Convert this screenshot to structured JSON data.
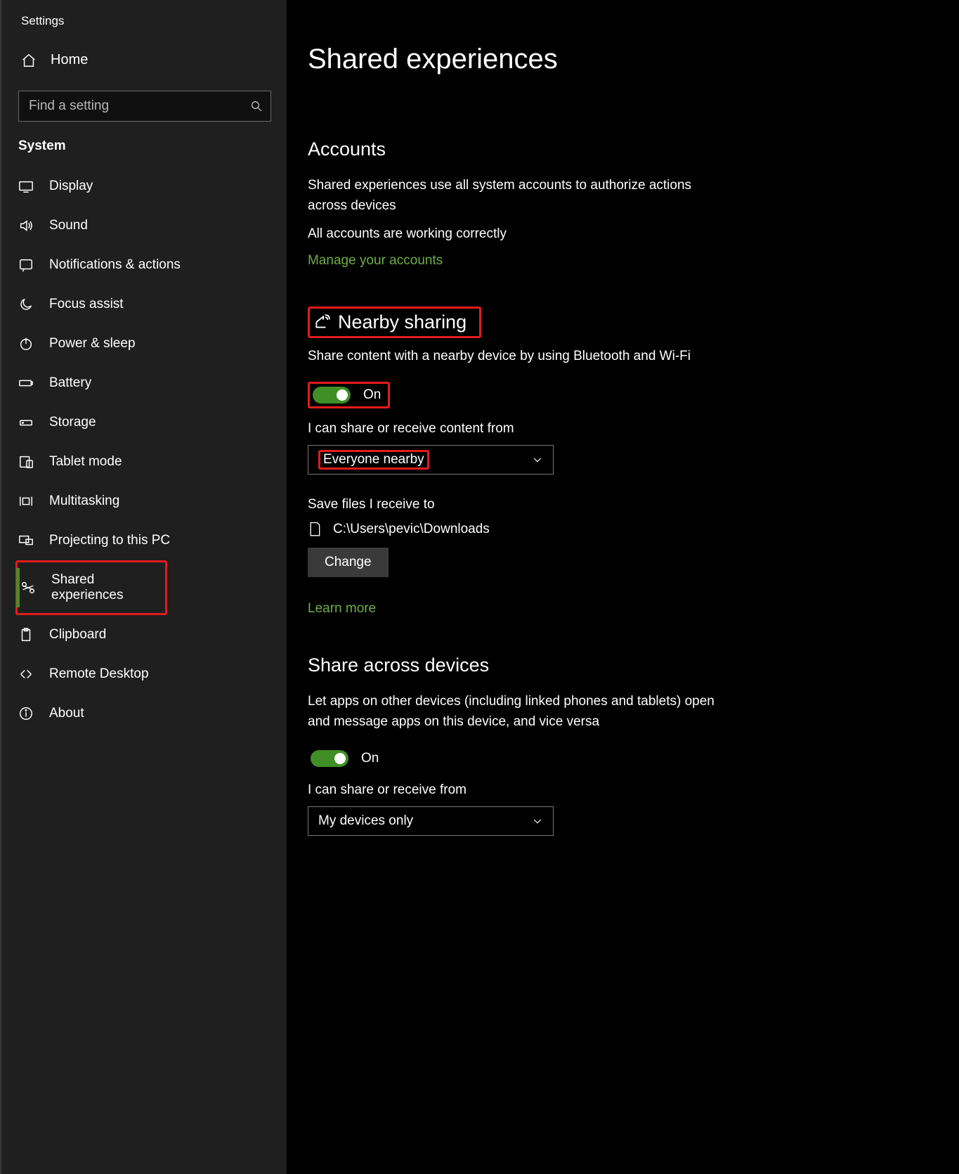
{
  "app_title": "Settings",
  "home_label": "Home",
  "search_placeholder": "Find a setting",
  "category_label": "System",
  "sidebar": {
    "items": [
      {
        "label": "Display",
        "icon": "display-icon"
      },
      {
        "label": "Sound",
        "icon": "sound-icon"
      },
      {
        "label": "Notifications & actions",
        "icon": "notifications-icon"
      },
      {
        "label": "Focus assist",
        "icon": "focus-icon"
      },
      {
        "label": "Power & sleep",
        "icon": "power-icon"
      },
      {
        "label": "Battery",
        "icon": "battery-icon"
      },
      {
        "label": "Storage",
        "icon": "storage-icon"
      },
      {
        "label": "Tablet mode",
        "icon": "tablet-icon"
      },
      {
        "label": "Multitasking",
        "icon": "multitask-icon"
      },
      {
        "label": "Projecting to this PC",
        "icon": "project-icon"
      },
      {
        "label": "Shared experiences",
        "icon": "share-icon"
      },
      {
        "label": "Clipboard",
        "icon": "clipboard-icon"
      },
      {
        "label": "Remote Desktop",
        "icon": "remote-icon"
      },
      {
        "label": "About",
        "icon": "about-icon"
      }
    ]
  },
  "main": {
    "page_title": "Shared experiences",
    "accounts": {
      "title": "Accounts",
      "desc": "Shared experiences use all system accounts to authorize actions across devices",
      "status": "All accounts are working correctly",
      "link": "Manage your accounts"
    },
    "nearby": {
      "title": "Nearby sharing",
      "desc": "Share content with a nearby device by using Bluetooth and Wi-Fi",
      "toggle_label": "On",
      "share_label": "I can share or receive content from",
      "share_value": "Everyone nearby",
      "save_label": "Save files I receive to",
      "save_path": "C:\\Users\\pevic\\Downloads",
      "change_btn": "Change",
      "learn_more": "Learn more"
    },
    "across": {
      "title": "Share across devices",
      "desc": "Let apps on other devices (including linked phones and tablets) open and message apps on this device, and vice versa",
      "toggle_label": "On",
      "share_label": "I can share or receive from",
      "share_value": "My devices only"
    }
  }
}
